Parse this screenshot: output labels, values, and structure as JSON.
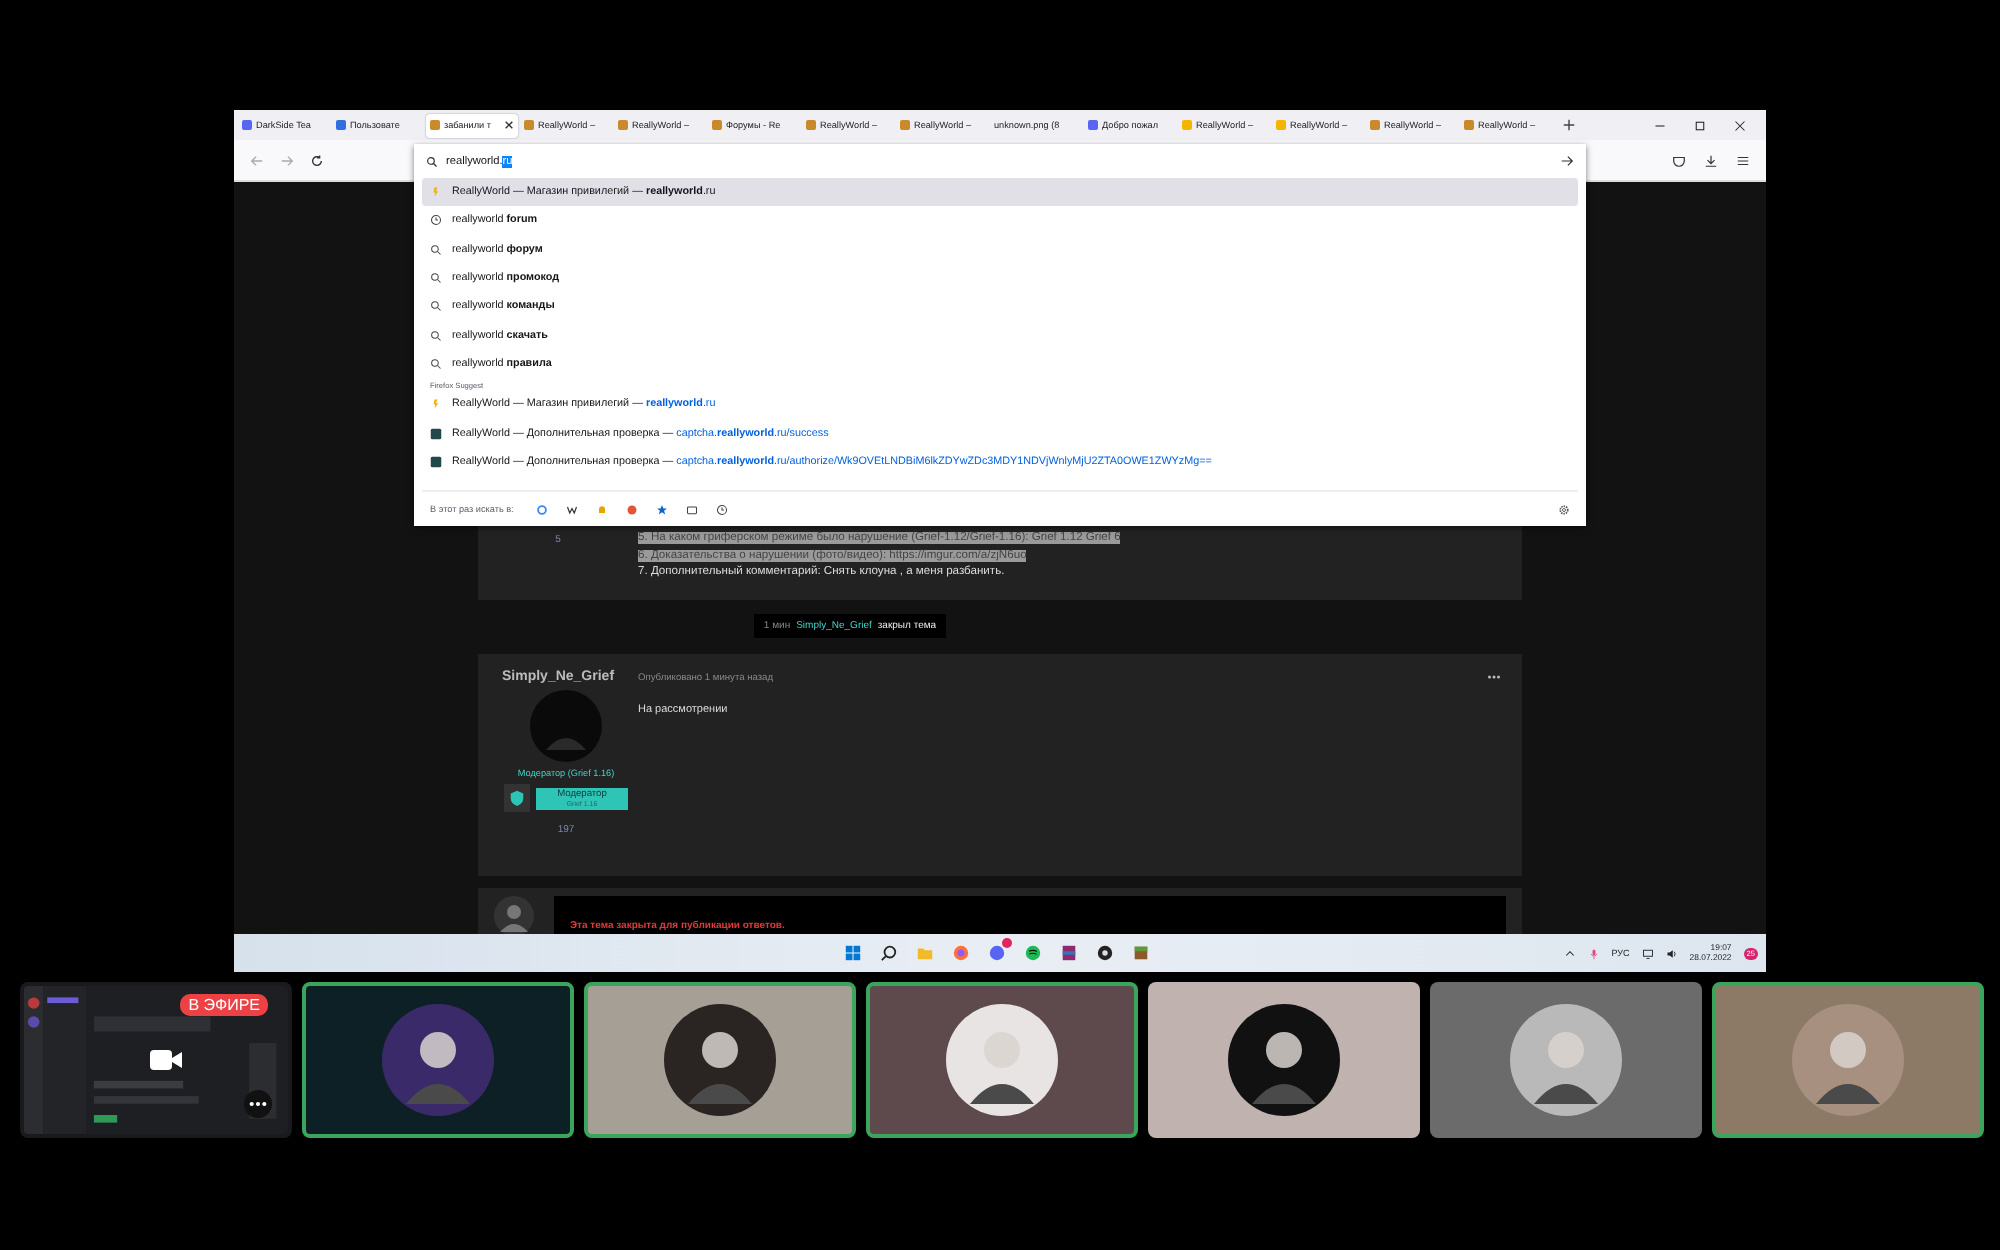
{
  "browser": {
    "tabs": [
      {
        "label": "DarkSide Tea",
        "kind": "discord",
        "selected": false
      },
      {
        "label": "Пользовате",
        "kind": "letter",
        "selected": false
      },
      {
        "label": "забанили т",
        "kind": "cube",
        "selected": true
      },
      {
        "label": "ReallyWorld –",
        "kind": "cube",
        "selected": false
      },
      {
        "label": "ReallyWorld –",
        "kind": "cube",
        "selected": false
      },
      {
        "label": "Форумы - Re",
        "kind": "cube",
        "selected": false
      },
      {
        "label": "ReallyWorld –",
        "kind": "cube",
        "selected": false
      },
      {
        "label": "ReallyWorld –",
        "kind": "cube",
        "selected": false
      },
      {
        "label": "unknown.png (8",
        "selected": false
      },
      {
        "label": "Добро пожал",
        "kind": "discord",
        "selected": false
      },
      {
        "label": "ReallyWorld –",
        "kind": "bolt",
        "selected": false
      },
      {
        "label": "ReallyWorld –",
        "kind": "bolt",
        "selected": false
      },
      {
        "label": "ReallyWorld –",
        "kind": "cube",
        "selected": false
      },
      {
        "label": "ReallyWorld –",
        "kind": "cube",
        "selected": false
      }
    ],
    "address_bar": {
      "value": "reallyworld.",
      "selected_text": "ru"
    },
    "results": [
      {
        "kind": "site",
        "text": "ReallyWorld — Магазин привилегий — ",
        "url": "**reallyworld**.ru",
        "selected": true
      },
      {
        "kind": "history",
        "text": "reallyworld **forum**",
        "selected": false
      },
      {
        "kind": "search",
        "text": "reallyworld **форум**",
        "selected": false
      },
      {
        "kind": "search",
        "text": "reallyworld **промокод**",
        "selected": false
      },
      {
        "kind": "search",
        "text": "reallyworld **команды**",
        "selected": false
      },
      {
        "kind": "search",
        "text": "reallyworld **скачать**",
        "selected": false
      },
      {
        "kind": "search",
        "text": "reallyworld **правила**",
        "selected": false
      }
    ],
    "section_label": "Firefox Suggest",
    "suggestions": [
      {
        "kind": "site",
        "text": "ReallyWorld — Магазин привилегий — ",
        "url": "**reallyworld**.ru",
        "selected": false
      },
      {
        "kind": "captcha",
        "text": "ReallyWorld — Дополнительная проверка — ",
        "url": "captcha.**reallyworld**.ru/success",
        "selected": false
      },
      {
        "kind": "captcha",
        "text": "ReallyWorld — Дополнительная проверка — ",
        "url": "captcha.**reallyworld**.ru/authorize/Wk9OVEtLNDBiM6lkZDYwZDc3MDY1NDVjWnlyMjU2ZTA0OWE1ZWYzMg==",
        "selected": false
      }
    ],
    "search_label": "В этот раз искать в:"
  },
  "forum": {
    "first_post": {
      "reactions": "5",
      "lines": [
        {
          "text": "5. На каком гриферском режиме было нарушение (Grief-1.12/Grief-1.16): Grief 1.12 Grief 6",
          "highlighted": true
        },
        {
          "text": "6. Доказательства о нарушении (фото/видео): https://imgur.com/a/zjN6uo",
          "highlighted": true
        },
        {
          "text": "7. Дополнительный комментарий: Снять клоуна , а меня разбанить.",
          "highlighted": false
        }
      ]
    },
    "event": {
      "time": "1 мин",
      "user": "Simply_Ne_Grief",
      "action": "закрыл тема"
    },
    "post": {
      "author": "Simply_Ne_Grief",
      "published": "Опубликовано 1 минута назад",
      "body": "На рассмотрении",
      "role": "Модератор (Grief 1.16)",
      "badge_title": "Модератор",
      "badge_sub": "Grief 1.16",
      "reactions": "197"
    },
    "locked_notice": "Эта тема закрыта для публикации ответов."
  },
  "taskbar": {
    "language": "РУС",
    "time": "19:07",
    "date": "28.07.2022",
    "notifications": "25"
  },
  "tiles": [
    {
      "kind": "stream",
      "live_label": "В ЭФИРЕ",
      "speaking": false,
      "color": "#1a1a1e"
    },
    {
      "kind": "avatar",
      "speaking": true,
      "color": "#0d2026"
    },
    {
      "kind": "avatar",
      "speaking": true,
      "color": "#a69f96"
    },
    {
      "kind": "avatar",
      "speaking": true,
      "color": "#5e4a4c"
    },
    {
      "kind": "avatar",
      "speaking": false,
      "color": "#c0b2ae"
    },
    {
      "kind": "avatar",
      "speaking": false,
      "color": "#6b6b6b"
    },
    {
      "kind": "avatar",
      "speaking": true,
      "color": "#8c7a66"
    }
  ]
}
